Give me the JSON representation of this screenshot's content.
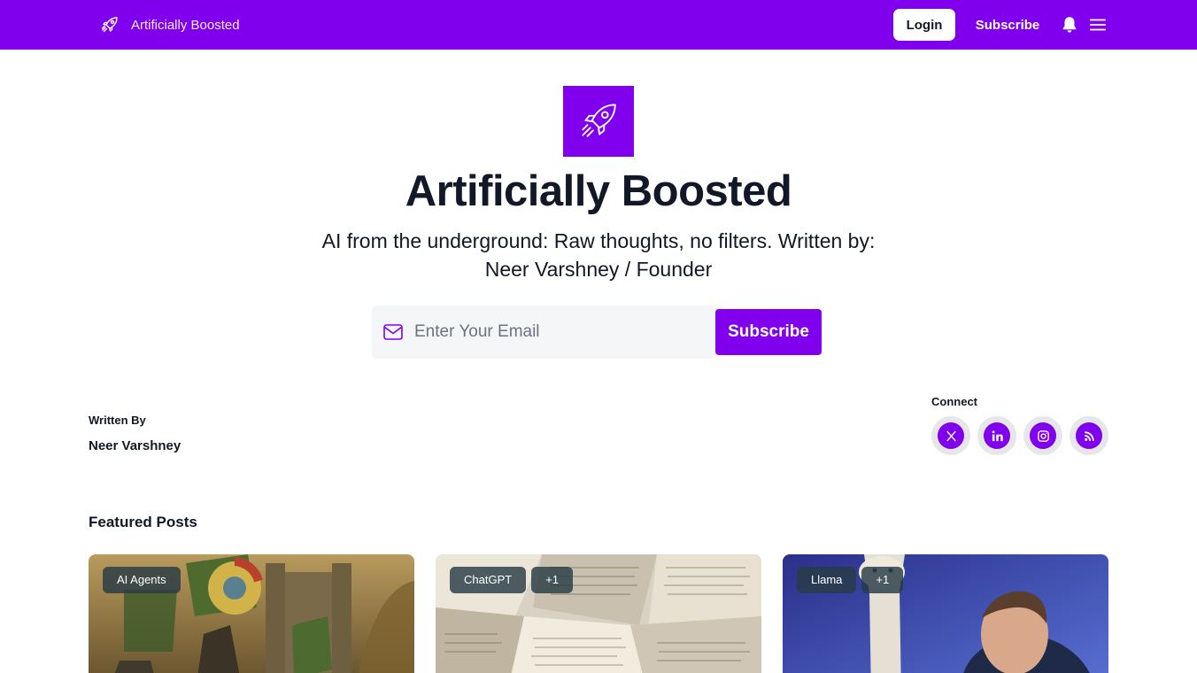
{
  "brand": {
    "name": "Artificially Boosted",
    "icon": "rocket-icon"
  },
  "nav": {
    "login_label": "Login",
    "subscribe_label": "Subscribe",
    "notifications_icon": "bell-icon",
    "menu_icon": "hamburger-menu-icon"
  },
  "hero": {
    "title": "Artificially Boosted",
    "tagline": "AI from the underground: Raw thoughts, no filters. Written by: Neer Varshney / Founder",
    "email_placeholder": "Enter Your Email",
    "email_value": "",
    "subscribe_label": "Subscribe"
  },
  "author": {
    "label": "Written By",
    "name": "Neer Varshney"
  },
  "connect": {
    "label": "Connect",
    "icons": [
      "x-icon",
      "linkedin-icon",
      "instagram-icon",
      "rss-icon"
    ]
  },
  "featured": {
    "title": "Featured Posts",
    "cards": [
      {
        "tags": [
          "AI Agents"
        ]
      },
      {
        "tags": [
          "ChatGPT",
          "+1"
        ]
      },
      {
        "tags": [
          "Llama",
          "+1"
        ]
      }
    ]
  },
  "colors": {
    "accent": "#8000ee",
    "text": "#111827",
    "input_bg": "#f5f6f8"
  }
}
